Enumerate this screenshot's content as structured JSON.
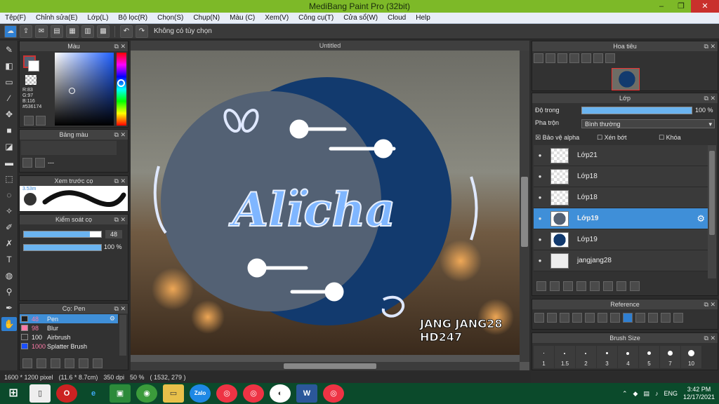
{
  "window": {
    "title": "MediBang Paint Pro (32bit)",
    "minimize": "–",
    "restore": "❐",
    "close": "✕"
  },
  "menu": [
    "Tệp(F)",
    "Chỉnh sửa(E)",
    "Lớp(L)",
    "Bộ lọc(R)",
    "Chọn(S)",
    "Chụp(N)",
    "Màu (C)",
    "Xem(V)",
    "Công cụ(T)",
    "Cửa sổ(W)",
    "Cloud",
    "Help"
  ],
  "toolbar": {
    "selection_status": "Không có tùy chọn"
  },
  "color_panel": {
    "title": "Màu",
    "r_label": "R:83",
    "g_label": "G:97",
    "b_label": "B:116",
    "hex_label": "#536174",
    "main_color": "#536174"
  },
  "palette_panel": {
    "title": "Bảng màu",
    "placeholder": "---"
  },
  "brush_preview": {
    "title": "Xem trước cọ",
    "size_label": "3.53m"
  },
  "brush_control": {
    "title": "Kiểm soát cọ",
    "size_value": "48",
    "opacity_value": "100 %",
    "size_fraction": 0.85,
    "opacity_fraction": 1.0
  },
  "brush_list": {
    "title": "Cọ: Pen",
    "items": [
      {
        "size": "48",
        "name": "Pen",
        "color": "#1e1e1e",
        "selected": true
      },
      {
        "size": "98",
        "name": "Blur",
        "color": "#ff7aa8",
        "selected": false
      },
      {
        "size": "100",
        "name": "Airbrush",
        "color": "#333333",
        "selected": false
      },
      {
        "size": "1000",
        "name": "Splatter Brush",
        "color": "#1b4fff",
        "selected": false
      }
    ]
  },
  "canvas": {
    "tab": "Untitled",
    "title_text": "Alïcha",
    "signature_line1": "JANG JANG28",
    "signature_line2": "HD247",
    "colors": {
      "navy": "#123a6e",
      "slate": "#536174",
      "accent": "#7fb6ff"
    }
  },
  "navigator": {
    "title": "Hoa tiêu"
  },
  "layer_panel": {
    "title": "Lớp",
    "opacity_label": "Độ trong",
    "opacity_value": "100 %",
    "blend_label": "Pha trộn",
    "blend_value": "Bình thường",
    "protect_alpha": "Bảo vệ alpha",
    "clipping": "Xén bớt",
    "lock": "Khóa",
    "layers": [
      {
        "name": "Lớp21",
        "selected": false,
        "thumb": "blank"
      },
      {
        "name": "Lớp18",
        "selected": false,
        "thumb": "blank"
      },
      {
        "name": "Lớp18",
        "selected": false,
        "thumb": "blank"
      },
      {
        "name": "Lớp19",
        "selected": true,
        "thumb": "slate-circle"
      },
      {
        "name": "Lớp19",
        "selected": false,
        "thumb": "navy-circle"
      },
      {
        "name": "jangjang28",
        "selected": false,
        "thumb": "text"
      }
    ]
  },
  "reference_panel": {
    "title": "Reference"
  },
  "brush_size_panel": {
    "title": "Brush Size",
    "sizes": [
      "1",
      "1.5",
      "2",
      "3",
      "4",
      "5",
      "7",
      "10"
    ]
  },
  "status": {
    "dimensions": "1600 * 1200 pixel",
    "physical": "(11.6 * 8.7cm)",
    "dpi": "350 dpi",
    "zoom": "50 %",
    "coords": "( 1532, 279 )"
  },
  "taskbar": {
    "time": "3:42 PM",
    "date": "12/17/2021",
    "language": "ENG"
  }
}
